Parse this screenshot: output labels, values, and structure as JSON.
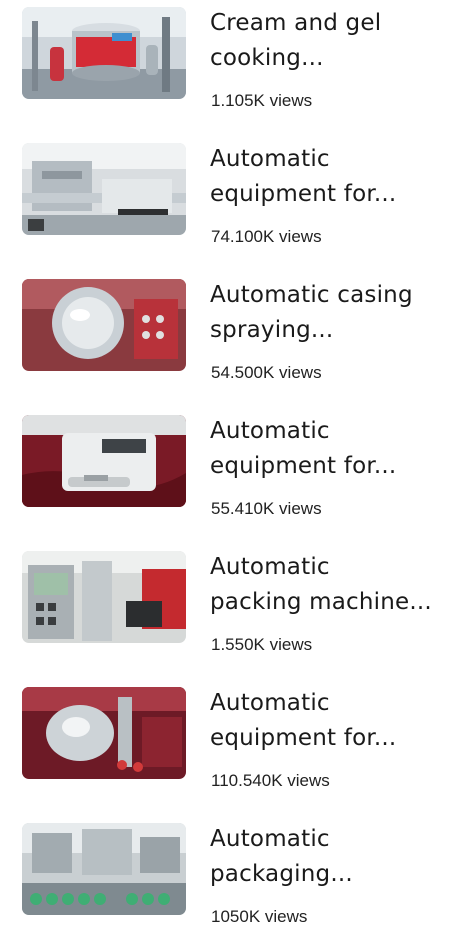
{
  "videos": [
    {
      "title_line1": "Cream and gel",
      "title_line2": "cooking...",
      "views": "1.105K views",
      "thumb_icon": "stainless-mixing-tank-image"
    },
    {
      "title_line1": "Automatic",
      "title_line2": "equipment for...",
      "views": "74.100K views",
      "thumb_icon": "conveyor-equipment-image"
    },
    {
      "title_line1": "Automatic casing",
      "title_line2": "spraying...",
      "views": "54.500K views",
      "thumb_icon": "coating-drum-image"
    },
    {
      "title_line1": "Automatic",
      "title_line2": "equipment for...",
      "views": "55.410K views",
      "thumb_icon": "tablet-tester-image"
    },
    {
      "title_line1": "Automatic",
      "title_line2": "packing machine...",
      "views": "1.550K views",
      "thumb_icon": "packing-machine-image"
    },
    {
      "title_line1": "Automatic",
      "title_line2": "equipment for...",
      "views": "110.540K views",
      "thumb_icon": "polishing-pan-image"
    },
    {
      "title_line1": "Automatic",
      "title_line2": "packaging...",
      "views": "1050K views",
      "thumb_icon": "bottle-packaging-line-image"
    }
  ]
}
